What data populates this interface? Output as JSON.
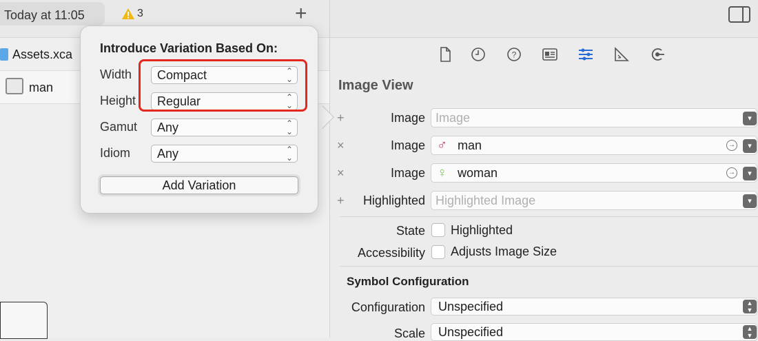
{
  "toolbar": {
    "date": "Today at 11:05",
    "warnings": "3",
    "add": "+"
  },
  "navigator": {
    "assets": "Assets.xca",
    "image_set": "man"
  },
  "popover": {
    "title": "Introduce Variation Based On:",
    "rows": [
      {
        "label": "Width",
        "value": "Compact"
      },
      {
        "label": "Height",
        "value": "Regular"
      },
      {
        "label": "Gamut",
        "value": "Any"
      },
      {
        "label": "Idiom",
        "value": "Any"
      }
    ],
    "add_button": "Add Variation"
  },
  "inspector": {
    "tabs": [
      "file-icon",
      "history-icon",
      "help-icon",
      "identity-icon",
      "attributes-icon",
      "size-icon",
      "connections-icon"
    ],
    "section": "Image View",
    "image_rows": [
      {
        "action": "+",
        "label": "Image",
        "value": "",
        "placeholder": "Image",
        "symbol": ""
      },
      {
        "action": "×",
        "label": "Image",
        "value": "man",
        "placeholder": "",
        "symbol": "♂"
      },
      {
        "action": "×",
        "label": "Image",
        "value": "woman",
        "placeholder": "",
        "symbol": "♀"
      },
      {
        "action": "+",
        "label": "Highlighted",
        "value": "",
        "placeholder": "Highlighted Image",
        "symbol": ""
      }
    ],
    "state": {
      "label": "State",
      "option": "Highlighted"
    },
    "accessibility": {
      "label": "Accessibility",
      "option": "Adjusts Image Size"
    },
    "symbol_config": {
      "title": "Symbol Configuration",
      "configuration": {
        "label": "Configuration",
        "value": "Unspecified"
      },
      "scale": {
        "label": "Scale",
        "value": "Unspecified"
      }
    }
  },
  "colors": {
    "accent": "#2a6cd6",
    "highlight_box": "#e0281f",
    "male": "#c0395a",
    "female": "#6fcf3f"
  }
}
